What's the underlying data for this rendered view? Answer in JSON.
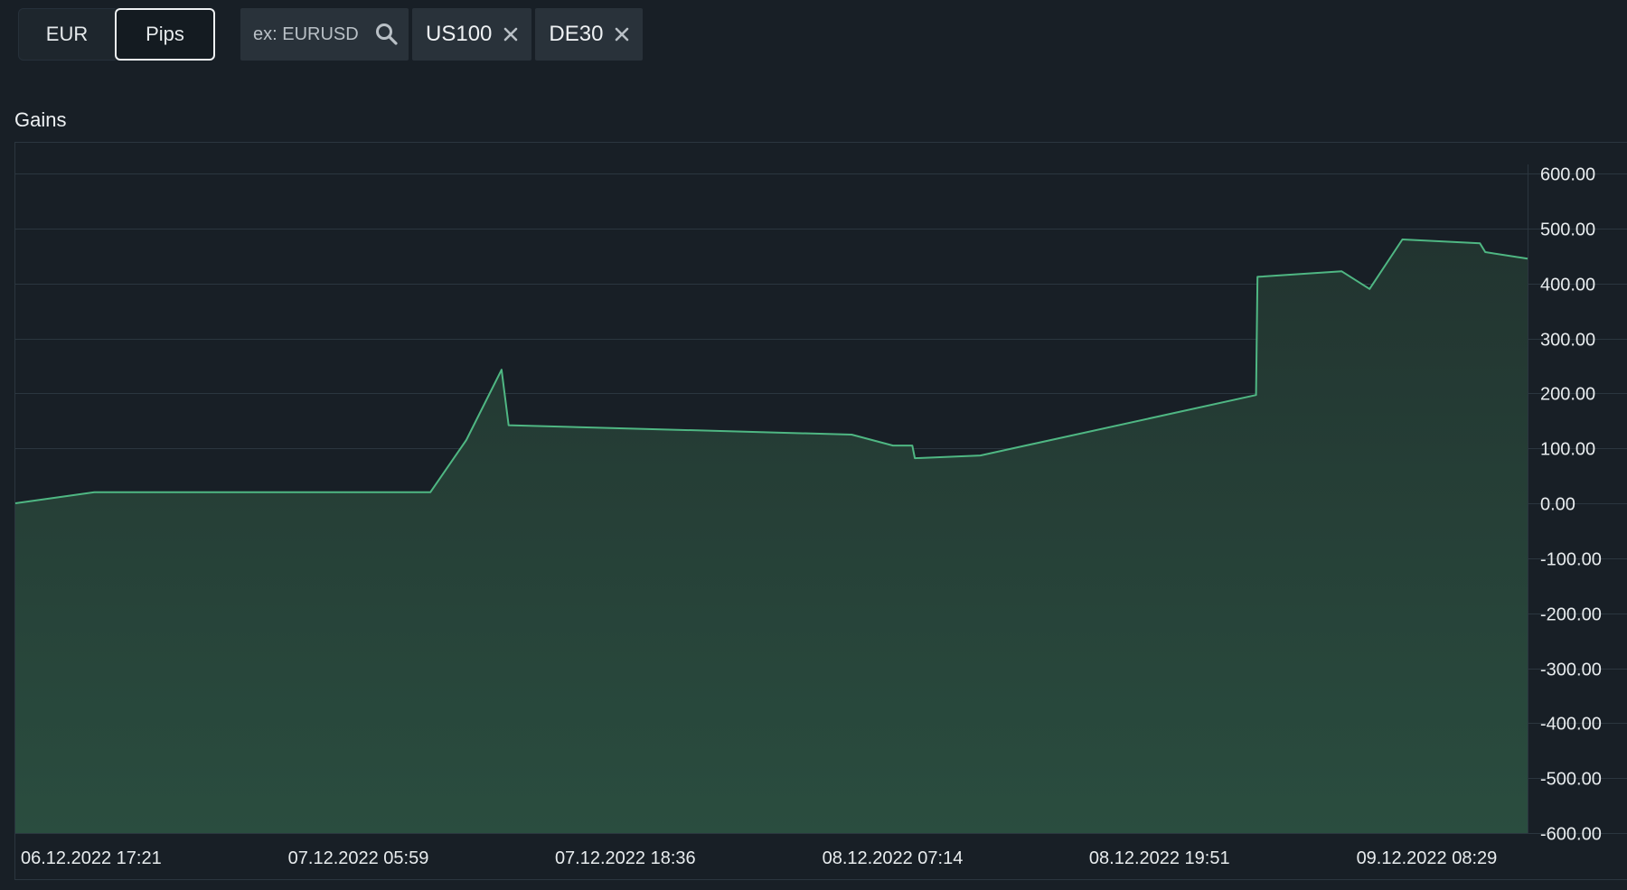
{
  "toolbar": {
    "unit_toggle": [
      "EUR",
      "Pips"
    ],
    "active_unit": "Pips",
    "search": {
      "placeholder": "ex: EURUSD",
      "icon": "search-icon"
    },
    "chips": [
      {
        "label": "US100",
        "icon": "close-icon"
      },
      {
        "label": "DE30",
        "icon": "close-icon"
      }
    ]
  },
  "panel": {
    "title": "Gains"
  },
  "colors": {
    "background": "#181f26",
    "line": "#4fb783",
    "area_top": "#223430",
    "area_bottom": "#2a4d3f",
    "grid": "#2b363f"
  },
  "chart_data": {
    "type": "area",
    "title": "Gains",
    "xlabel": "",
    "ylabel": "",
    "ylim": [
      -600,
      600
    ],
    "y_ticks": [
      "600.00",
      "500.00",
      "400.00",
      "300.00",
      "200.00",
      "100.00",
      "0.00",
      "-100.00",
      "-200.00",
      "-300.00",
      "-400.00",
      "-500.00",
      "-600.00"
    ],
    "x_tick_labels": [
      "06.12.2022 17:21",
      "07.12.2022 05:59",
      "07.12.2022 18:36",
      "08.12.2022 07:14",
      "08.12.2022 19:51",
      "09.12.2022 08:29"
    ],
    "x_range": [
      "06.12.2022 17:21",
      "09.12.2022 16:50"
    ],
    "grid": true,
    "axis_position": "right",
    "series": [
      {
        "points": [
          {
            "x": "06.12.2022 17:21",
            "y": 0
          },
          {
            "x": "06.12.2022 21:05",
            "y": 20
          },
          {
            "x": "07.12.2022 12:58",
            "y": 20
          },
          {
            "x": "07.12.2022 14:40",
            "y": 115
          },
          {
            "x": "07.12.2022 16:20",
            "y": 243
          },
          {
            "x": "07.12.2022 16:40",
            "y": 142
          },
          {
            "x": "08.12.2022 08:53",
            "y": 125
          },
          {
            "x": "08.12.2022 10:50",
            "y": 105
          },
          {
            "x": "08.12.2022 11:45",
            "y": 105
          },
          {
            "x": "08.12.2022 11:52",
            "y": 82
          },
          {
            "x": "08.12.2022 14:58",
            "y": 87
          },
          {
            "x": "09.12.2022 04:00",
            "y": 197
          },
          {
            "x": "09.12.2022 04:04",
            "y": 412
          },
          {
            "x": "09.12.2022 08:03",
            "y": 422
          },
          {
            "x": "09.12.2022 09:22",
            "y": 390
          },
          {
            "x": "09.12.2022 10:55",
            "y": 480
          },
          {
            "x": "09.12.2022 14:35",
            "y": 473
          },
          {
            "x": "09.12.2022 14:50",
            "y": 457
          },
          {
            "x": "09.12.2022 16:50",
            "y": 445
          }
        ]
      }
    ]
  }
}
